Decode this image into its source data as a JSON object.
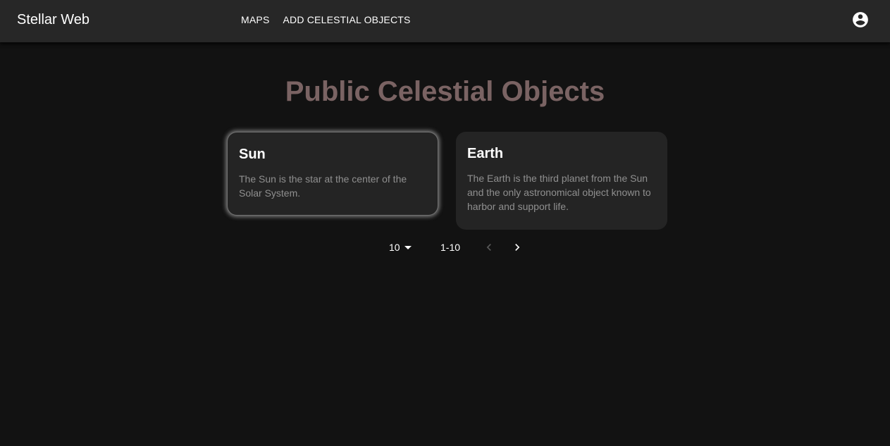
{
  "header": {
    "brand": "Stellar Web",
    "nav": [
      "MAPS",
      "ADD CELESTIAL OBJECTS"
    ],
    "account_icon": "account-circle-icon"
  },
  "page": {
    "title": "Public Celestial Objects"
  },
  "cards": [
    {
      "name": "Sun",
      "description": "The Sun is the star at the center of the Solar System."
    },
    {
      "name": "Earth",
      "description": "The Earth is the third planet from the Sun and the only astronomical object known to harbor and support life."
    }
  ],
  "pagination": {
    "rows_per_page": "10",
    "range": "1-10",
    "prev_icon": "chevron-left-icon",
    "next_icon": "chevron-right-icon",
    "prev_disabled": true
  },
  "colors": {
    "background": "#121212",
    "appbar": "#272727",
    "card": "#242424",
    "title": "#7a6363",
    "description": "#8f8f8f"
  }
}
